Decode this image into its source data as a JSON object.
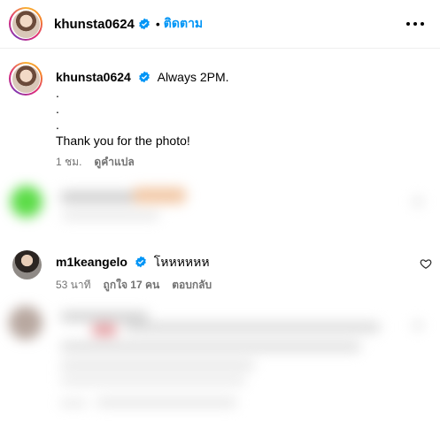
{
  "header": {
    "username": "khunsta0624",
    "separator": "•",
    "follow_label": "ติดตาม"
  },
  "caption": {
    "username": "khunsta0624",
    "text_first": "Always 2PM.",
    "lines": [
      ".",
      ".",
      ".",
      "Thank you for the photo!"
    ],
    "time": "1 ชม.",
    "translate_label": "ดูคำแปล"
  },
  "comment": {
    "username": "m1keangelo",
    "text": "โหหหหหห",
    "time": "53 นาที",
    "likes": "ถูกใจ 17 คน",
    "reply_label": "ตอบกลับ"
  },
  "colors": {
    "link_blue": "#0095f6",
    "verified_blue": "#0095f6",
    "muted_gray": "#737373"
  }
}
